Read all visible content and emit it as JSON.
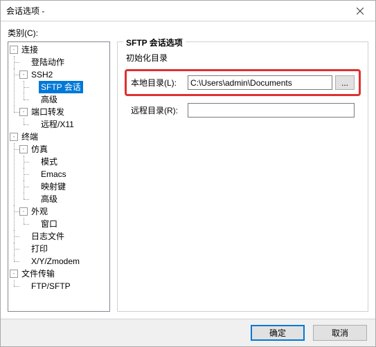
{
  "window": {
    "title": "会话选项 - "
  },
  "category_label": "类别(C):",
  "tree": {
    "connection": "连接",
    "login_actions": "登陆动作",
    "ssh2": "SSH2",
    "sftp_session": "SFTP 会话",
    "advanced": "高级",
    "port_fwd": "端口转发",
    "remote_x11": "远程/X11",
    "terminal": "终端",
    "emulation": "仿真",
    "modes": "模式",
    "emacs": "Emacs",
    "mapped_keys": "映射键",
    "advanced2": "高级",
    "appearance": "外观",
    "window_item": "窗口",
    "log_file": "日志文件",
    "printing": "打印",
    "xyz": "X/Y/Zmodem",
    "file_transfer": "文件传输",
    "ftp_sftp": "FTP/SFTP"
  },
  "panel": {
    "title": "SFTP 会话选项",
    "init_dir_heading": "初始化目录",
    "local_dir_label": "本地目录(L):",
    "local_dir_value": "C:\\Users\\admin\\Documents",
    "browse": "...",
    "remote_dir_label": "远程目录(R):",
    "remote_dir_value": ""
  },
  "buttons": {
    "ok": "确定",
    "cancel": "取消"
  }
}
